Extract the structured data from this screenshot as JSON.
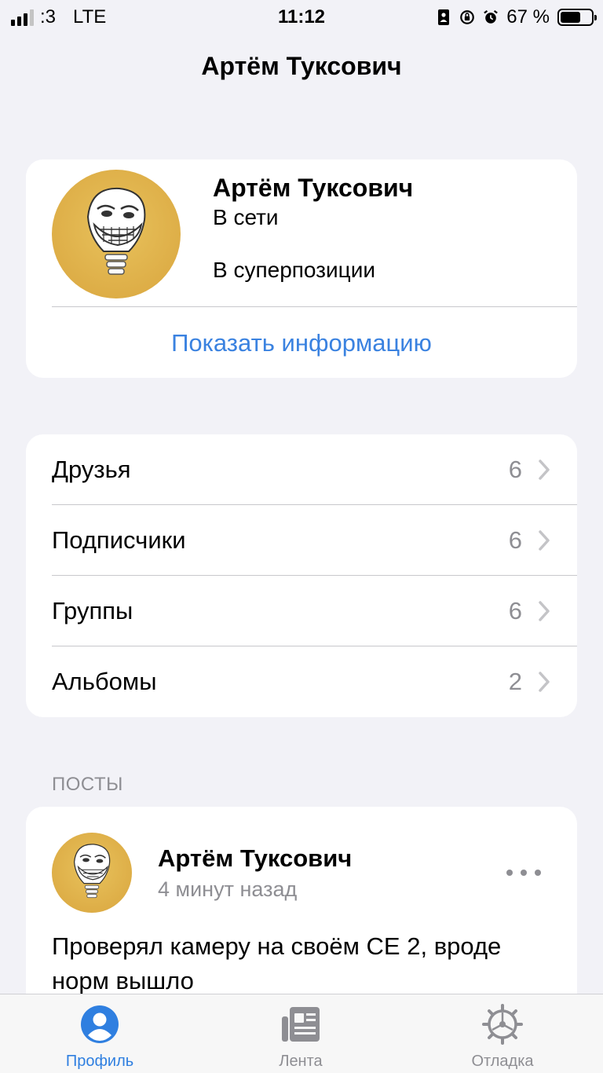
{
  "status_bar": {
    "carrier": ":3",
    "network": "LTE",
    "time": "11:12",
    "battery_percent": "67 %",
    "battery_level": 0.67,
    "icons": [
      "portrait-lock-icon",
      "rotation-lock-icon",
      "alarm-icon"
    ]
  },
  "nav": {
    "title": "Артём Туксович"
  },
  "profile": {
    "name": "Артём Туксович",
    "status": "В сети",
    "substatus": "В суперпозиции",
    "show_info": "Показать информацию",
    "avatar": "trollface-lightbulb-avatar"
  },
  "menu": {
    "items": [
      {
        "label": "Друзья",
        "count": "6"
      },
      {
        "label": "Подписчики",
        "count": "6"
      },
      {
        "label": "Группы",
        "count": "6"
      },
      {
        "label": "Альбомы",
        "count": "2"
      }
    ]
  },
  "posts": {
    "header": "ПОСТЫ",
    "items": [
      {
        "author": "Артём Туксович",
        "time": "4 минут назад",
        "text": "Проверял камеру на своём CE 2, вроде норм вышло"
      }
    ]
  },
  "tab_bar": {
    "tabs": [
      {
        "label": "Профиль",
        "icon": "person-circle-icon",
        "active": true
      },
      {
        "label": "Лента",
        "icon": "newspaper-icon",
        "active": false
      },
      {
        "label": "Отладка",
        "icon": "gear-icon",
        "active": false
      }
    ]
  },
  "colors": {
    "accent": "#2f7fe0",
    "link": "#3a82e0",
    "background": "#f2f2f7",
    "secondary_text": "#8e8e93"
  }
}
